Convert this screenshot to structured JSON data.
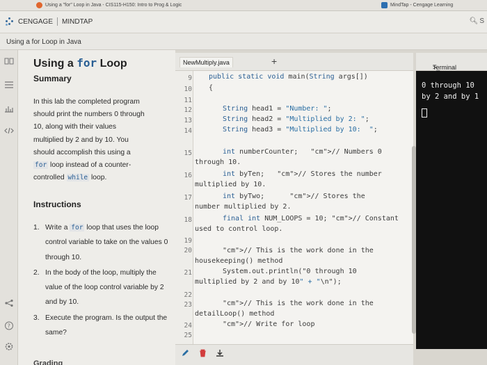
{
  "browser": {
    "tab_title": "Using a \"for\" Loop in Java - CIS115-H150: Intro to Prog & Logic",
    "tab2_title": "MindTap - Cengage Learning"
  },
  "brand": {
    "cengage": "CENGAGE",
    "mindtap": "MINDTAP",
    "search": "S"
  },
  "breadcrumb": "Using a for Loop in Java",
  "rail_icons": [
    "book-icon",
    "list-icon",
    "chart-icon",
    "code-icon",
    "share-icon",
    "help-icon",
    "settings-icon"
  ],
  "instructions": {
    "title_pre": "Using a ",
    "title_code": "for",
    "title_post": " Loop",
    "summary_heading": "Summary",
    "summary_lines": [
      "In this lab the completed program",
      "should print the numbers 0 through",
      "10, along with their values",
      "multiplied by 2 and by 10. You",
      "should accomplish this using a",
      "loop instead of a counter-",
      "controlled",
      "loop."
    ],
    "code_for": "for",
    "code_while": "while",
    "instructions_heading": "Instructions",
    "steps": [
      {
        "num": "1.",
        "pre": "Write a ",
        "code": "for",
        "post": " loop that uses the loop control variable to take on the values 0 through 10."
      },
      {
        "num": "2.",
        "pre": "In the body of the loop, multiply the value of the loop control variable by 2 and by 10.",
        "code": "",
        "post": ""
      },
      {
        "num": "3.",
        "pre": "Execute the program. Is the output the same?",
        "code": "",
        "post": ""
      }
    ],
    "next_heading_partial": "Grading"
  },
  "editor": {
    "filename": "NewMultiply.java",
    "add_tab": "+",
    "lines": [
      {
        "n": "9",
        "text": "public static void main(String args[])"
      },
      {
        "n": "10",
        "text": "{"
      },
      {
        "n": "11",
        "text": ""
      },
      {
        "n": "12",
        "text": "String head1 = \"Number: \";"
      },
      {
        "n": "13",
        "text": "String head2 = \"Multiplied by 2: \";"
      },
      {
        "n": "14",
        "text": "String head3 = \"Multiplied by 10:  \";"
      },
      {
        "n": "15",
        "text": "int numberCounter;   // Numbers 0 through 10."
      },
      {
        "n": "16",
        "text": "int byTen;   // Stores the number multiplied by 10."
      },
      {
        "n": "17",
        "text": "int byTwo;      // Stores the number multiplied by 2."
      },
      {
        "n": "18",
        "text": "final int NUM_LOOPS = 10; // Constant used to control loop."
      },
      {
        "n": "19",
        "text": ""
      },
      {
        "n": "20",
        "text": "// This is the work done in the housekeeping() method"
      },
      {
        "n": "21",
        "text": "System.out.println(\"0 through 10 multiplied by 2 and by 10\" + \"\\n\");"
      },
      {
        "n": "22",
        "text": ""
      },
      {
        "n": "23",
        "text": "// This is the work done in the detailLoop() method"
      },
      {
        "n": "24",
        "text": "// Write for loop"
      },
      {
        "n": "25",
        "text": ""
      }
    ]
  },
  "terminal": {
    "label": "Terminal",
    "output": "0 through 10\nby 2 and by 1"
  }
}
